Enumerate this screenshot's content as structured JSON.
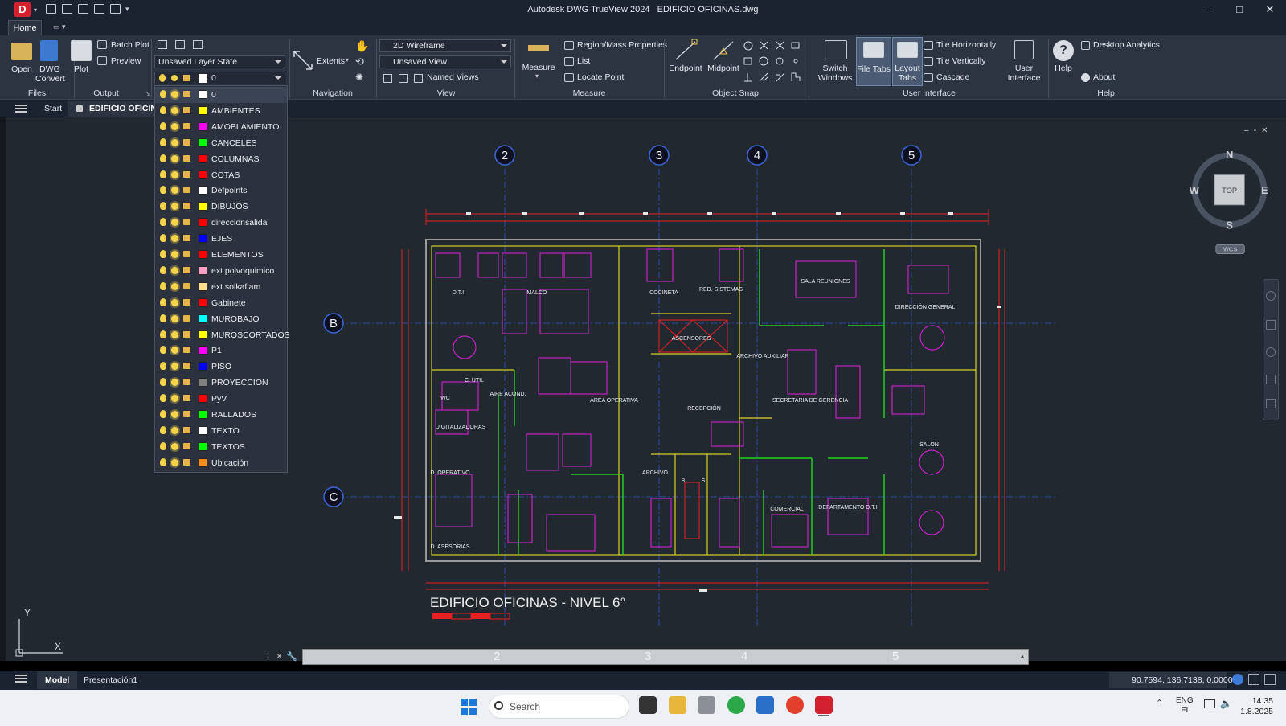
{
  "window": {
    "app_badge": "D",
    "title": "Autodesk DWG TrueView 2024",
    "file": "EDIFICIO OFICINAS.dwg",
    "minimize": "–",
    "maximize": "□",
    "close": "✕"
  },
  "ribbon_tabs": {
    "home": "Home"
  },
  "ribbon": {
    "files": {
      "open": "Open",
      "dwg_convert_1": "DWG",
      "dwg_convert_2": "Convert",
      "label": "Files"
    },
    "output": {
      "plot": "Plot",
      "batch_plot": "Batch Plot",
      "preview": "Preview",
      "label": "Output"
    },
    "layers": {
      "layer_state": "Unsaved Layer State",
      "current_layer": "0"
    },
    "navigation": {
      "extents": "Extents",
      "label": "Navigation"
    },
    "view": {
      "visual_style": "2D Wireframe",
      "named_view": "Unsaved View",
      "named_views": "Named Views",
      "label": "View"
    },
    "measure": {
      "measure": "Measure",
      "region_mass": "Region/Mass Properties",
      "list": "List",
      "locate_point": "Locate Point",
      "label": "Measure"
    },
    "object_snap": {
      "endpoint": "Endpoint",
      "midpoint": "Midpoint",
      "label": "Object Snap"
    },
    "user_interface": {
      "switch_1": "Switch",
      "switch_2": "Windows",
      "file_tabs": "File Tabs",
      "layout_1": "Layout",
      "layout_2": "Tabs",
      "tile_h": "Tile Horizontally",
      "tile_v": "Tile Vertically",
      "cascade": "Cascade",
      "ui_1": "User",
      "ui_2": "Interface",
      "label": "User Interface"
    },
    "help": {
      "help": "Help",
      "desktop_analytics": "Desktop Analytics",
      "about": "About",
      "label": "Help"
    }
  },
  "file_tabs": {
    "start": "Start",
    "doc": "EDIFICIO OFICINA"
  },
  "layers_list": [
    {
      "name": "0",
      "color": "#ffffff"
    },
    {
      "name": "AMBIENTES",
      "color": "#ffff00"
    },
    {
      "name": "AMOBLAMIENTO",
      "color": "#ff00ff"
    },
    {
      "name": "CANCELES",
      "color": "#00ff00"
    },
    {
      "name": "COLUMNAS",
      "color": "#ff0000"
    },
    {
      "name": "COTAS",
      "color": "#ff0000"
    },
    {
      "name": "Defpoints",
      "color": "#ffffff"
    },
    {
      "name": "DIBUJOS",
      "color": "#ffff00"
    },
    {
      "name": "direccionsalida",
      "color": "#ff0000"
    },
    {
      "name": "EJES",
      "color": "#0000ff"
    },
    {
      "name": "ELEMENTOS",
      "color": "#ff0000"
    },
    {
      "name": "ext.polvoquimico",
      "color": "#ff9fc8"
    },
    {
      "name": "ext.solkaflam",
      "color": "#ffe08a"
    },
    {
      "name": "Gabinete",
      "color": "#ff0000"
    },
    {
      "name": "MUROBAJO",
      "color": "#00ffff"
    },
    {
      "name": "MUROSCORTADOS",
      "color": "#ffff00"
    },
    {
      "name": "P1",
      "color": "#ff00ff"
    },
    {
      "name": "PISO",
      "color": "#0000ff"
    },
    {
      "name": "PROYECCION",
      "color": "#808080"
    },
    {
      "name": "PyV",
      "color": "#ff0000"
    },
    {
      "name": "RALLADOS",
      "color": "#00ff00"
    },
    {
      "name": "TEXTO",
      "color": "#ffffff"
    },
    {
      "name": "TEXTOS",
      "color": "#00ff00"
    },
    {
      "name": "Ubicación",
      "color": "#ff8c1a"
    }
  ],
  "drawing": {
    "title": "EDIFICIO OFICINAS - NIVEL 6°",
    "axes_top": [
      "2",
      "3",
      "4",
      "5"
    ],
    "axes_side": [
      "B",
      "C"
    ],
    "rooms": [
      "D.T.I",
      "MALCO",
      "COCINETA",
      "RED. SISTEMAS",
      "SALA REUNIONES",
      "DIRECCIÓN GENERAL",
      "ASCENSORES",
      "ARCHIVO AUXILIAR",
      "C. UTIL",
      "WC",
      "AIRE ACOND.",
      "ÁREA OPERATIVA",
      "RECEPCIÓN",
      "SECRETARIA DE GERENCIA",
      "DIGITALIZADORAS",
      "SALÓN",
      "D. OPERATIVO",
      "ARCHIVO",
      "B",
      "S",
      "COMERCIAL",
      "DEPARTAMENTO D.T.I",
      "D. ASESORIAS"
    ]
  },
  "viewcube": {
    "n": "N",
    "s": "S",
    "e": "E",
    "w": "W",
    "top": "TOP",
    "wcs": "WCS"
  },
  "ucs": {
    "y": "Y",
    "x": "X"
  },
  "command_axes": [
    "2",
    "3",
    "4",
    "5"
  ],
  "status": {
    "model": "Model",
    "layout": "Presentación1",
    "coords": "90.7594, 136.7138, 0.0000"
  },
  "taskbar": {
    "search": "Search",
    "lang_1": "ENG",
    "lang_2": "FI",
    "time": "14.35",
    "date": "1.8.2025"
  }
}
